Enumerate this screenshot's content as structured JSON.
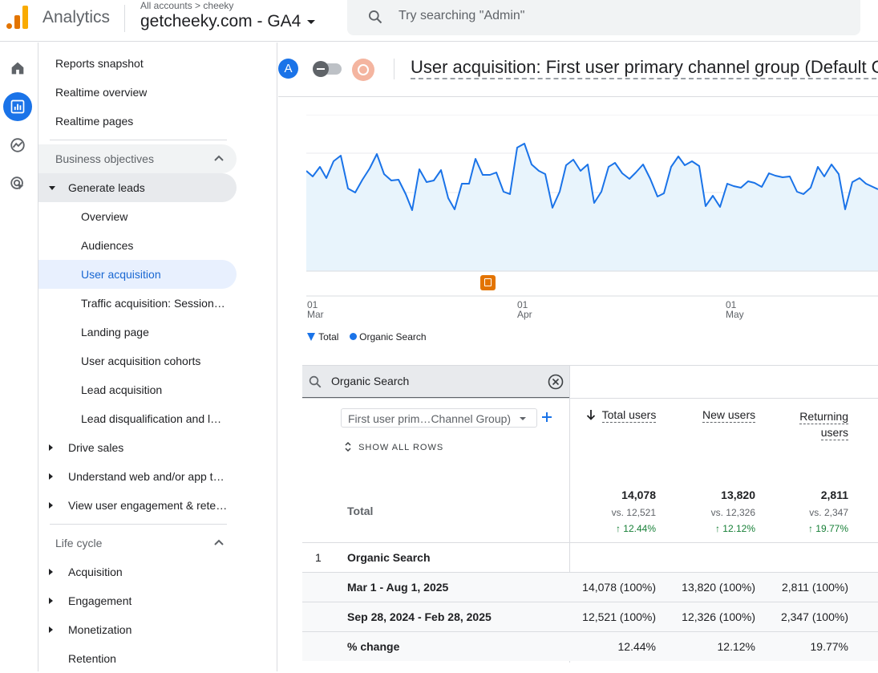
{
  "header": {
    "app_name": "Analytics",
    "breadcrumb_all": "All accounts",
    "breadcrumb_sep": ">",
    "breadcrumb_account": "cheeky",
    "property": "getcheeky.com - GA4",
    "search_placeholder": "Try searching \"Admin\""
  },
  "sidebar": {
    "top_items": [
      "Reports snapshot",
      "Realtime overview",
      "Realtime pages"
    ],
    "section_business": "Business objectives",
    "generate_leads": "Generate leads",
    "leads_items": [
      "Overview",
      "Audiences",
      "User acquisition",
      "Traffic acquisition: Session…",
      "Landing page",
      "User acquisition cohorts",
      "Lead acquisition",
      "Lead disqualification and l…"
    ],
    "objectives": [
      "Drive sales",
      "Understand web and/or app t…",
      "View user engagement & rete…"
    ],
    "section_lifecycle": "Life cycle",
    "lifecycle_items": [
      "Acquisition",
      "Engagement",
      "Monetization",
      "Retention"
    ]
  },
  "report": {
    "comparison_avatar": "A",
    "title": "User acquisition: First user primary channel group (Default C"
  },
  "chart_data": {
    "type": "area",
    "x_ticks": [
      {
        "day": "01",
        "month": "Mar"
      },
      {
        "day": "01",
        "month": "Apr"
      },
      {
        "day": "01",
        "month": "May"
      }
    ],
    "legend": [
      "Total",
      "Organic Search"
    ],
    "series_color": "#1a73e8",
    "fill_color": "#e8f4fc"
  },
  "table": {
    "search_value": "Organic Search",
    "dimension_select": "First user prim…Channel Group)",
    "show_all_rows": "SHOW ALL ROWS",
    "columns": [
      "Total users",
      "New users",
      "Returning",
      "users"
    ],
    "total_label": "Total",
    "totals": [
      {
        "value": "14,078",
        "vs": "vs. 12,521",
        "change": "↑ 12.44%"
      },
      {
        "value": "13,820",
        "vs": "vs. 12,326",
        "change": "↑ 12.12%"
      },
      {
        "value": "2,811",
        "vs": "vs. 2,347",
        "change": "↑ 19.77%"
      }
    ],
    "rows": [
      {
        "index": "1",
        "label": "Organic Search"
      },
      {
        "label": "Mar 1 - Aug 1, 2025",
        "values": [
          "14,078 (100%)",
          "13,820 (100%)",
          "2,811 (100%)"
        ]
      },
      {
        "label": "Sep 28, 2024 - Feb 28, 2025",
        "values": [
          "12,521 (100%)",
          "12,326 (100%)",
          "2,347 (100%)"
        ]
      },
      {
        "label": "% change",
        "values": [
          "12.44%",
          "12.12%",
          "19.77%"
        ]
      }
    ]
  }
}
